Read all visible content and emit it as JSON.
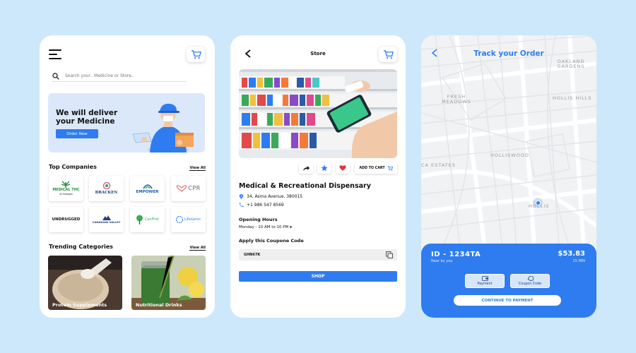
{
  "home": {
    "search_placeholder": "Search your.. Medicine or Store..",
    "banner_title": "We will deliver your Medicine",
    "order_now": "Order Now",
    "top_companies_title": "Top Companies",
    "view_all": "View All",
    "companies": [
      {
        "name": "MEDICAL THC",
        "sub": "of Georgia",
        "color": "#2a8a3c"
      },
      {
        "name": "BRACKEN",
        "sub": "",
        "color": "#1e3f78"
      },
      {
        "name": "EMPOWER",
        "sub": "",
        "color": "#1a5ea8"
      },
      {
        "name": "CPR",
        "sub": "",
        "color": "#666666"
      },
      {
        "name": "UNDRUGGED",
        "sub": "",
        "color": "#111111"
      },
      {
        "name": "CANADIAN VALLEY",
        "sub": "",
        "color": "#1e3f78"
      },
      {
        "name": "CanFirst",
        "sub": "",
        "color": "#3aaa5a"
      },
      {
        "name": "LifeGenic",
        "sub": "",
        "color": "#2f7cf0"
      }
    ],
    "trending_title": "Trending Categories",
    "categories": [
      "Protein Supplements",
      "Nutritional Drinks"
    ]
  },
  "store": {
    "title": "Store",
    "add_to_cart": "ADD TO CART",
    "name": "Medical & Recreational Dispensary",
    "address": "34, Asma Avenue, 380015",
    "phone": "+1 986 547 8569",
    "hours_label": "Opening Hours",
    "hours_value": "Monday - 10 AM to 10 PM",
    "coupon_label": "Apply this Coupone Code",
    "coupon_code": "GHN67K",
    "shop": "SHOP"
  },
  "track": {
    "title": "Track your Order",
    "map_labels": [
      "OAKLAND GARDENS",
      "FRESH MEADOWS",
      "HOLLIS HILLS",
      "HOLLISWOOD",
      "CA ESTATES",
      "HOLLIS"
    ],
    "order_id": "ID - 1234TA",
    "near": "Near by you",
    "price": "$53.83",
    "eta": "15 MIN",
    "payment": "Payment",
    "coupon": "Coupon Code",
    "continue": "CONTINUE TO PAYMENT"
  },
  "colors": {
    "accent": "#2f7cf0",
    "background": "#cde8fb"
  }
}
